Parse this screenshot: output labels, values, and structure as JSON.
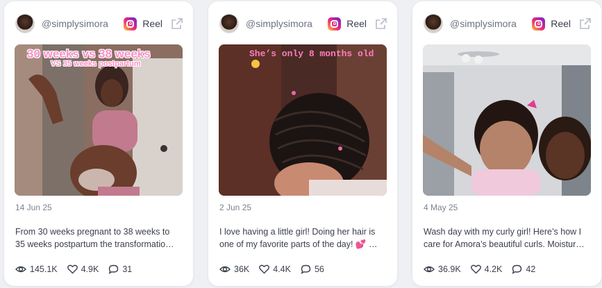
{
  "cards": [
    {
      "handle": "@simplysimora",
      "platform_label": "Reel",
      "platform_icon": "instagram-icon",
      "overlay_line1": "30 weeks vs 38 weeks",
      "overlay_line2": "VS 35 weeks postpartum",
      "date": "14 Jun 25",
      "caption_line1": "From 30 weeks pregnant to 38 weeks to",
      "caption_line2": "35 weeks postpartum the transformatio…",
      "views": "145.1K",
      "likes": "4.9K",
      "comments": "31"
    },
    {
      "handle": "@simplysimora",
      "platform_label": "Reel",
      "platform_icon": "instagram-icon",
      "overlay_line1": "She’s only 8 months old",
      "date": "2 Jun 25",
      "caption_line1": "I love having a little girl! Doing her hair is",
      "caption_line2": "one of my favorite parts of the day! 💕 …",
      "views": "36K",
      "likes": "4.4K",
      "comments": "56"
    },
    {
      "handle": "@simplysimora",
      "platform_label": "Reel",
      "platform_icon": "instagram-icon",
      "date": "4 May 25",
      "caption_line1": "Wash day with my curly girl! Here’s how I",
      "caption_line2": "care for Amora’s beautiful curls. Moistur…",
      "views": "36.9K",
      "likes": "4.2K",
      "comments": "42"
    }
  ],
  "colors": {
    "background": "#eef0f4",
    "card": "#ffffff",
    "text": "#3a3f4b",
    "muted": "#7b8290",
    "overlay_pink": "#ff8fc8"
  }
}
